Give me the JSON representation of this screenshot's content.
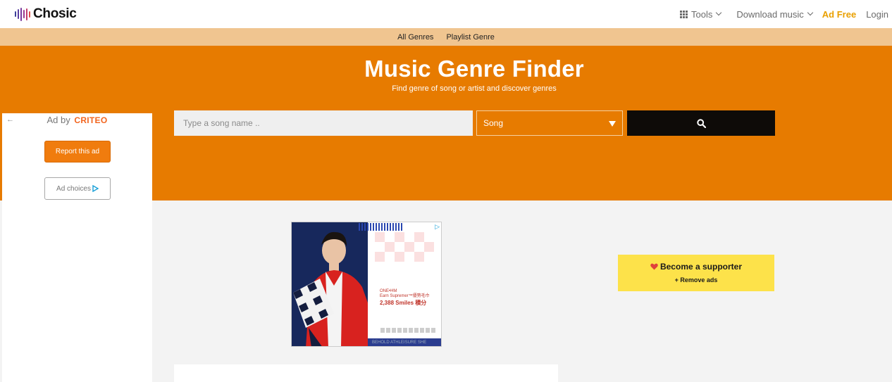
{
  "brand": {
    "name": "Chosic"
  },
  "topnav": {
    "tools_label": "Tools",
    "download_label": "Download music",
    "adfree_label": "Ad Free",
    "login_label": "Login"
  },
  "subnav": {
    "items": [
      "All Genres",
      "Playlist Genre"
    ]
  },
  "hero": {
    "title": "Music Genre Finder",
    "subtitle": "Find genre of song or artist and discover genres",
    "search_placeholder": "Type a song name ..",
    "search_value": "",
    "type_selected": "Song"
  },
  "ad_panel": {
    "back_glyph": "←",
    "ad_by": "Ad by",
    "network": "CRITEO",
    "report_label": "Report this ad",
    "choices_label": "Ad choices"
  },
  "banner_ad": {
    "promo_small_1": "ONE•HM",
    "promo_small_2": "Earn Supremer™優勢毛巾",
    "promo_big": "2,388 Smiles 積分",
    "footer": "BEHOLD ATHLEISURE SHE"
  },
  "supporter": {
    "title": "Become a supporter",
    "subtitle": "+ Remove ads"
  },
  "colors": {
    "accent": "#e77b00",
    "subnav_bg": "#f0c590",
    "adfree": "#e9a000",
    "supporter_bg": "#fde24a",
    "search_button": "#0e0b08"
  }
}
